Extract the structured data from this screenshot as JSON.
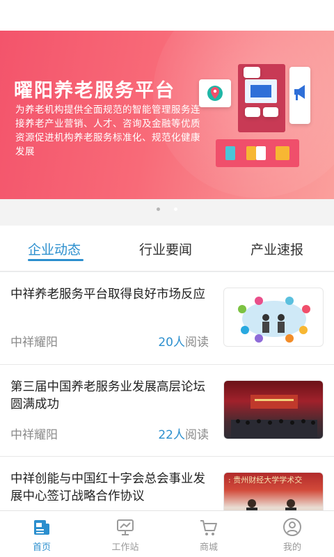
{
  "banner": {
    "title": "曜阳养老服务平台",
    "description": "为养老机构提供全面规范的智能管理服务连接养老产业营销、人才、咨询及金融等优质资源促进机构养老服务标准化、规范化健康发展",
    "carousel_count": 2,
    "carousel_active": 2
  },
  "tabs": [
    {
      "label": "企业动态",
      "active": true
    },
    {
      "label": "行业要闻",
      "active": false
    },
    {
      "label": "产业速报",
      "active": false
    }
  ],
  "news": [
    {
      "title": "中祥养老服务平台取得良好市场反应",
      "source": "中祥耀阳",
      "reads": "20人",
      "reads_suffix": "阅读",
      "thumb": "elderly-care-network-graphic"
    },
    {
      "title": "第三届中国养老服务业发展高层论坛圆满成功",
      "source": "中祥耀阳",
      "reads": "22人",
      "reads_suffix": "阅读",
      "thumb": "forum-stage-photo"
    },
    {
      "title": "中祥创能与中国红十字会总会事业发展中心签订战略合作协议",
      "source": "",
      "reads": "",
      "reads_suffix": "",
      "thumb": "signing-ceremony-photo",
      "banner_text": ": 贵州财经大学学术交"
    }
  ],
  "bottom_nav": [
    {
      "label": "首页",
      "icon": "home-news-icon",
      "active": true
    },
    {
      "label": "工作站",
      "icon": "workstation-icon",
      "active": false
    },
    {
      "label": "商城",
      "icon": "shopping-cart-icon",
      "active": false
    },
    {
      "label": "我的",
      "icon": "user-profile-icon",
      "active": false
    }
  ],
  "colors": {
    "accent": "#2c8fce",
    "banner_start": "#f3546b",
    "banner_end": "#fb9f9c"
  }
}
